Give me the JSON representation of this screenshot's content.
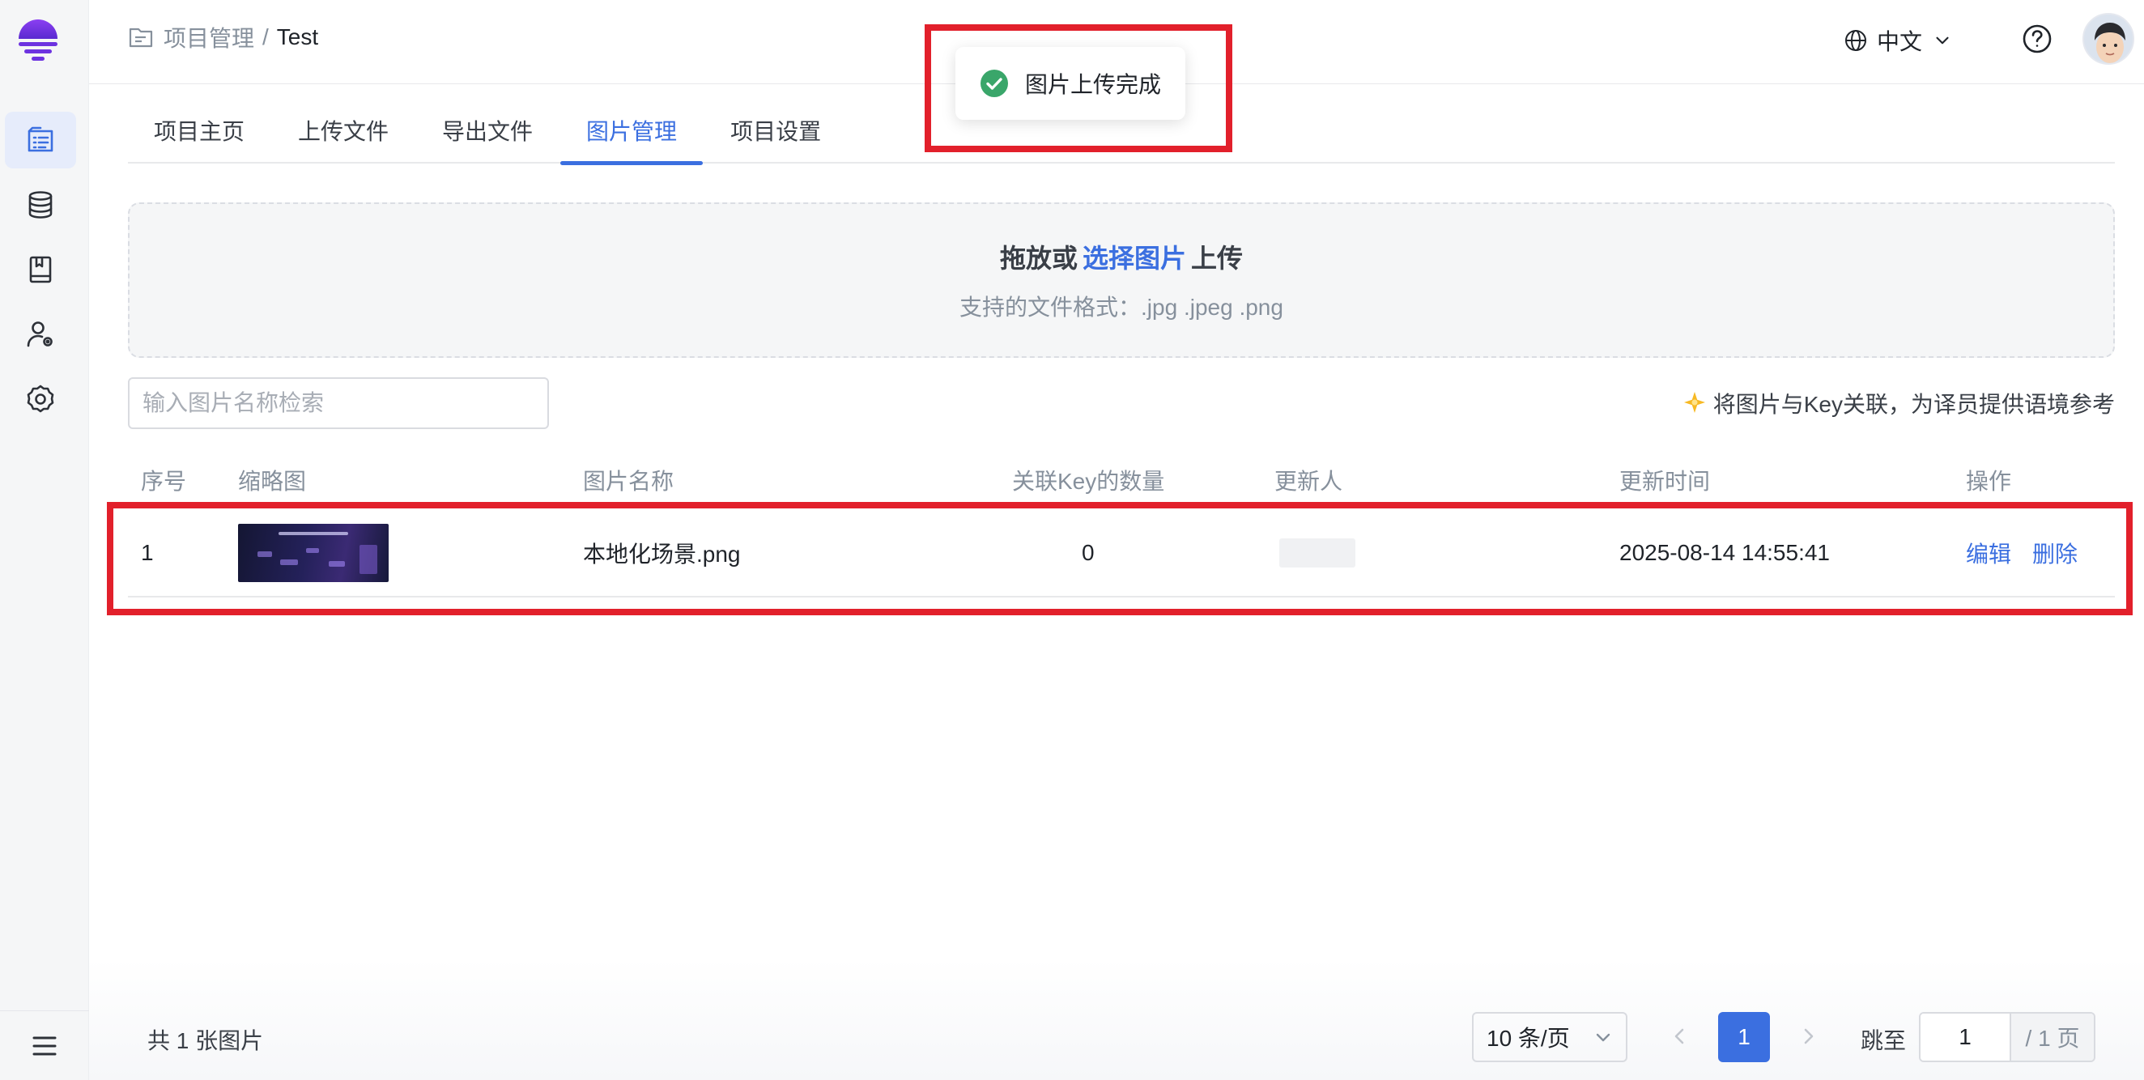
{
  "breadcrumb": {
    "parent": "项目管理",
    "separator": "/",
    "current": "Test"
  },
  "header": {
    "language": "中文"
  },
  "toast": {
    "message": "图片上传完成"
  },
  "tabs": [
    {
      "label": "项目主页"
    },
    {
      "label": "上传文件"
    },
    {
      "label": "导出文件"
    },
    {
      "label": "图片管理",
      "active": true
    },
    {
      "label": "项目设置"
    }
  ],
  "upload": {
    "prefix": "拖放或",
    "link": "选择图片",
    "suffix": "上传",
    "hint": "支持的文件格式：.jpg .jpeg .png"
  },
  "search": {
    "placeholder": "输入图片名称检索",
    "value": ""
  },
  "tip": {
    "text": "将图片与Key关联，为译员提供语境参考"
  },
  "table": {
    "columns": {
      "index": "序号",
      "thumbnail": "缩略图",
      "name": "图片名称",
      "key_count": "关联Key的数量",
      "updater": "更新人",
      "updated_at": "更新时间",
      "actions": "操作"
    },
    "rows": [
      {
        "index": "1",
        "name": "本地化场景.png",
        "key_count": "0",
        "updater": "",
        "updated_at": "2025-08-14 14:55:41",
        "edit": "编辑",
        "delete": "删除"
      }
    ]
  },
  "footer": {
    "total": "共 1 张图片",
    "page_size": "10 条/页",
    "current_page": "1",
    "jump_label": "跳至",
    "jump_value": "1",
    "page_total": "/ 1 页"
  },
  "colors": {
    "accent": "#3b6fe0",
    "success": "#3aa66a",
    "highlight": "#e2202b"
  },
  "icons": {
    "sidebar": [
      "list-icon",
      "database-icon",
      "book-icon",
      "user-settings-icon",
      "gear-icon",
      "menu-icon"
    ],
    "header": [
      "folder-icon",
      "globe-icon",
      "chevron-down-icon",
      "help-icon"
    ]
  }
}
